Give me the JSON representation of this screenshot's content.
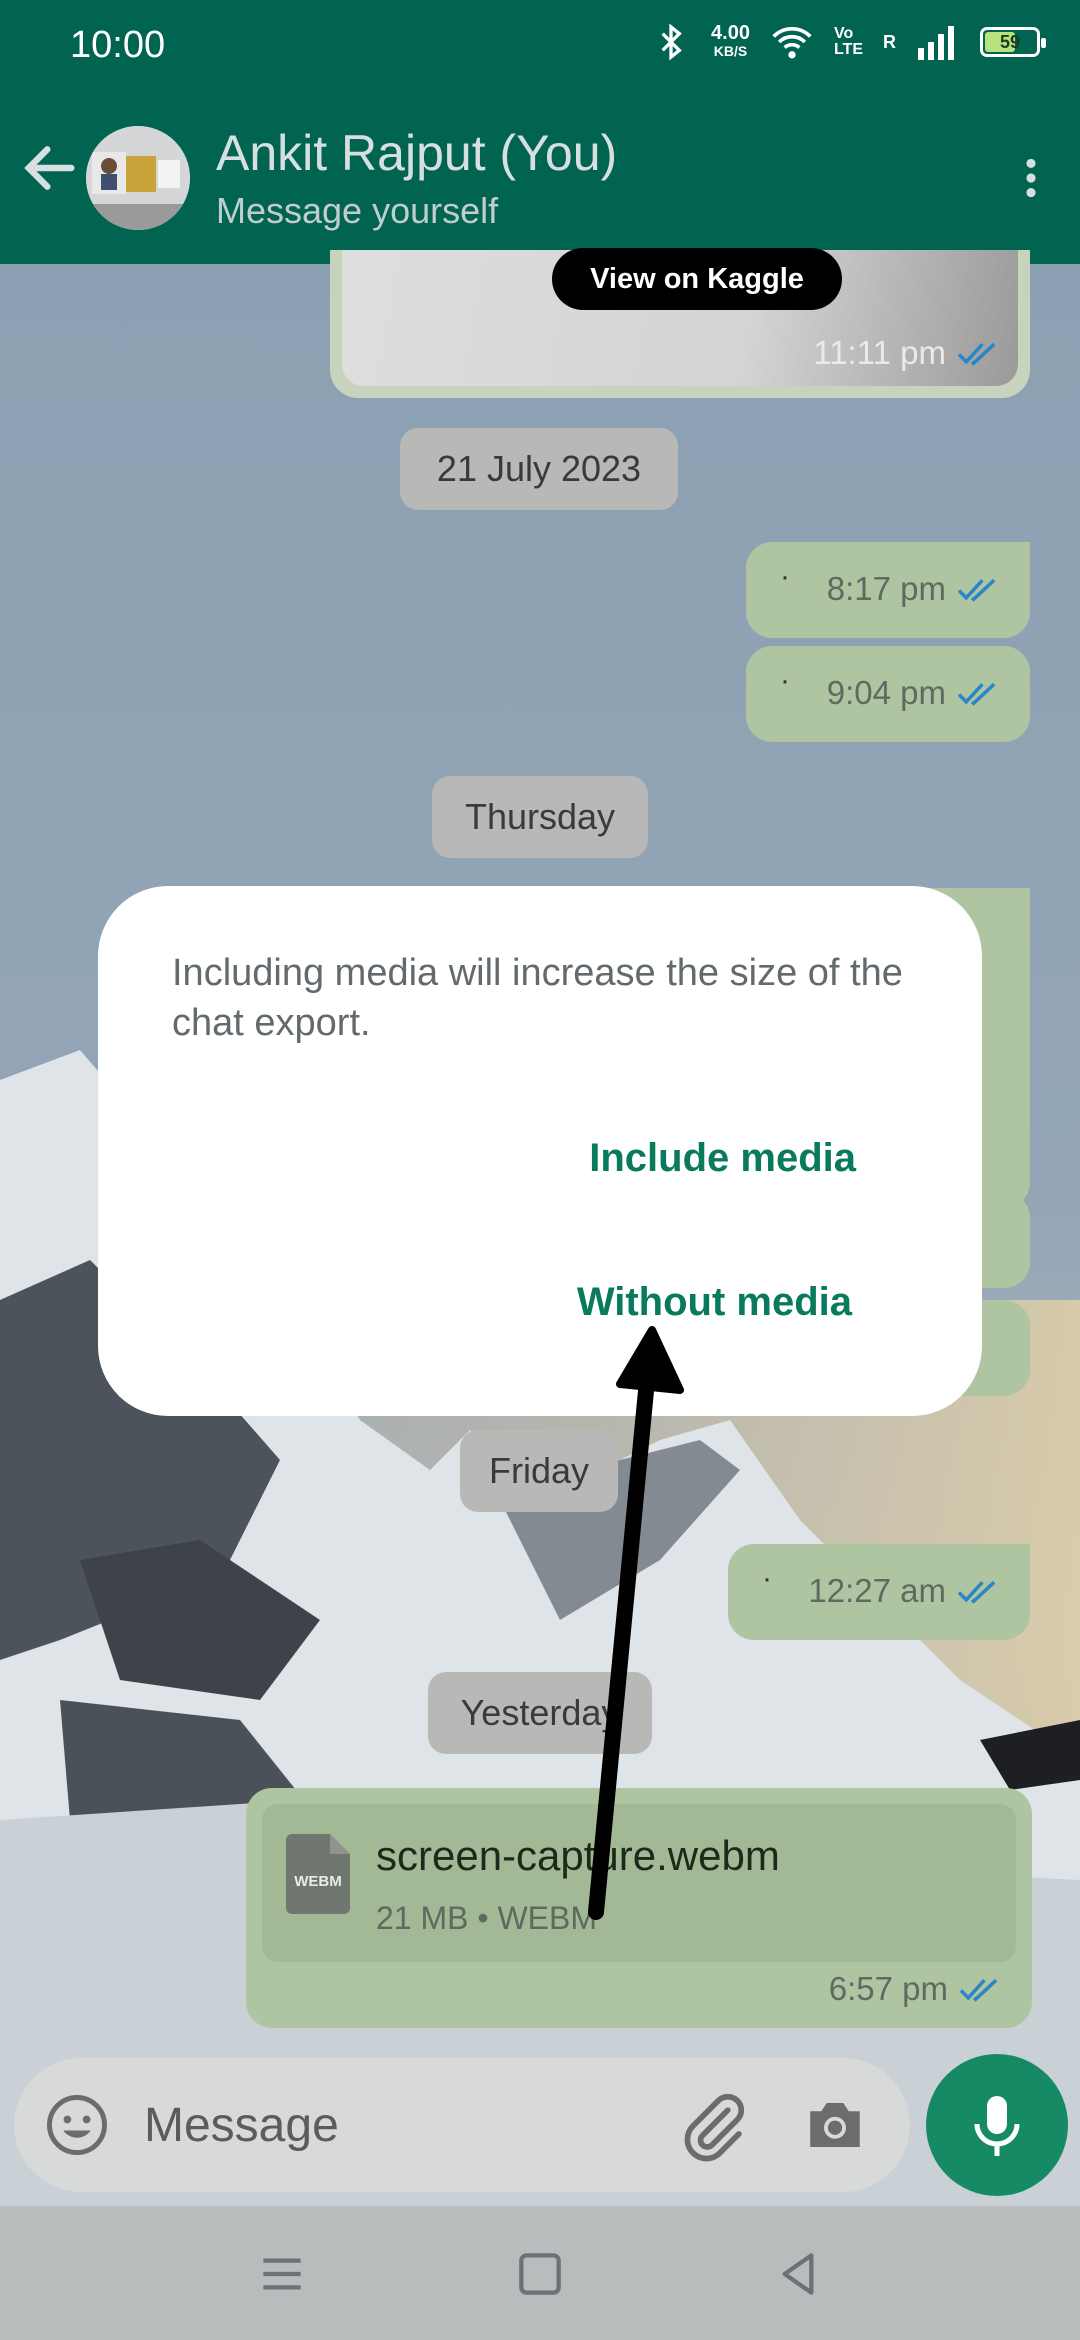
{
  "status_bar": {
    "time": "10:00",
    "speed_value": "4.00",
    "speed_unit": "KB/S",
    "volte_top": "Vo",
    "volte_bottom": "LTE",
    "signal_label": "R",
    "battery": "59"
  },
  "header": {
    "name": "Ankit Rajput (You)",
    "subtitle": "Message yourself"
  },
  "chat": {
    "kaggle_card": {
      "button": "View on Kaggle",
      "time": "11:11 pm"
    },
    "date_1": "21 July 2023",
    "msg_1": {
      "dot": "·",
      "time": "8:17 pm"
    },
    "msg_2": {
      "dot": "·",
      "time": "9:04 pm"
    },
    "date_2": "Thursday",
    "date_3": "Friday",
    "msg_3": {
      "dot": "·",
      "time": "12:27 am"
    },
    "date_4": "Yesterday",
    "file": {
      "icon_label": "WEBM",
      "name": "screen-capture.webm",
      "info": "21 MB • WEBM",
      "time": "6:57 pm"
    }
  },
  "dialog": {
    "message": "Including media will increase the size of the chat export.",
    "include_label": "Include media",
    "without_label": "Without media"
  },
  "composer": {
    "placeholder": "Message"
  },
  "colors": {
    "header": "#016450",
    "accent": "#0a7a5e",
    "outgoing_bubble": "#afc5a1",
    "read_tick": "#2a86c6"
  }
}
